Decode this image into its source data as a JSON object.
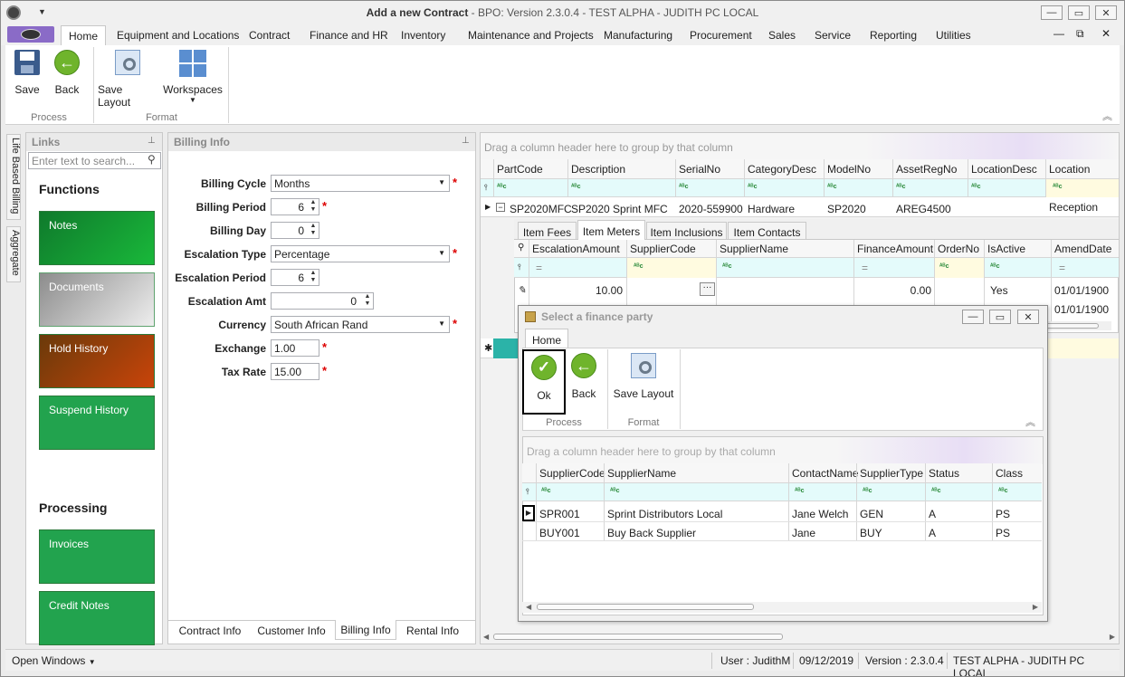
{
  "window": {
    "title_bold": "Add a new Contract",
    "title_rest": " - BPO: Version 2.3.0.4 - TEST ALPHA - JUDITH PC LOCAL"
  },
  "menu": [
    "Home",
    "Equipment and Locations",
    "Contract",
    "Finance and HR",
    "Inventory",
    "Maintenance and Projects",
    "Manufacturing",
    "Procurement",
    "Sales",
    "Service",
    "Reporting",
    "Utilities"
  ],
  "ribbon": {
    "save": "Save",
    "back": "Back",
    "save_layout": "Save Layout",
    "workspaces": "Workspaces",
    "group_process": "Process",
    "group_format": "Format"
  },
  "side_tabs": {
    "tab1": "Life Based Billing",
    "tab2": "Aggregate"
  },
  "links": {
    "title": "Links",
    "search_placeholder": "Enter text to search...",
    "functions_heading": "Functions",
    "functions": [
      "Notes",
      "Documents",
      "Hold History",
      "Suspend History"
    ],
    "processing_heading": "Processing",
    "processing": [
      "Invoices",
      "Credit Notes"
    ]
  },
  "billing": {
    "title": "Billing Info",
    "labels": [
      "Billing Cycle",
      "Billing Period",
      "Billing Day",
      "Escalation Type",
      "Escalation Period",
      "Escalation Amt",
      "Currency",
      "Exchange",
      "Tax Rate"
    ],
    "billing_cycle": "Months",
    "billing_period": "6",
    "billing_day": "0",
    "escalation_type": "Percentage",
    "escalation_period": "6",
    "escalation_amt": "0",
    "currency": "South African Rand",
    "exchange": "1.00",
    "tax_rate": "15.00",
    "tabs": [
      "Contract Info",
      "Customer Info",
      "Billing Info",
      "Rental Info"
    ]
  },
  "main_grid": {
    "group_hint": "Drag a column header here to group by that column",
    "columns": [
      "PartCode",
      "Description",
      "SerialNo",
      "CategoryDesc",
      "ModelNo",
      "AssetRegNo",
      "LocationDesc",
      "Location"
    ],
    "row": [
      "SP2020MFC",
      "SP2020 Sprint MFC",
      "2020-559900",
      "Hardware",
      "SP2020",
      "AREG4500",
      "",
      "Reception"
    ],
    "detail_tabs": [
      "Item Fees",
      "Item Meters",
      "Item Inclusions",
      "Item Contacts"
    ],
    "detail_columns": [
      "EscalationAmount",
      "SupplierCode",
      "SupplierName",
      "FinanceAmount",
      "OrderNo",
      "IsActive",
      "AmendDate"
    ],
    "detail_rows": [
      [
        "10.00",
        "",
        "",
        "0.00",
        "",
        "Yes",
        "01/01/1900"
      ],
      [
        "",
        "",
        "",
        "",
        "",
        "",
        "01/01/1900"
      ]
    ]
  },
  "dialog": {
    "title": "Select a finance party",
    "tab": "Home",
    "ok": "Ok",
    "back": "Back",
    "save_layout": "Save Layout",
    "group_process": "Process",
    "group_format": "Format",
    "group_hint": "Drag a column header here to group by that column",
    "columns": [
      "SupplierCode",
      "SupplierName",
      "ContactName",
      "SupplierType",
      "Status",
      "Class"
    ],
    "rows": [
      [
        "SPR001",
        "Sprint Distributors Local",
        "Jane Welch",
        "GEN",
        "A",
        "PS"
      ],
      [
        "BUY001",
        "Buy Back Supplier",
        "Jane",
        "BUY",
        "A",
        "PS"
      ]
    ]
  },
  "statusbar": {
    "open_windows": "Open Windows",
    "user": "User : JudithM",
    "date": "09/12/2019",
    "version": "Version : 2.3.0.4",
    "env": "TEST ALPHA - JUDITH PC LOCAL"
  },
  "colors": {
    "green_dark": "#1f9a48",
    "green_bright": "#22b34a",
    "grey_btn": "#b5b5b5",
    "hold_orange": "#c0440a",
    "filter_row": "#e4fbfb",
    "teal_cell": "#2bb3a8"
  },
  "icons": [
    "save-icon",
    "back-arrow-icon",
    "save-layout-icon",
    "workspaces-icon",
    "ok-check-icon",
    "pin-icon",
    "search-icon",
    "dropdown-arrow-icon",
    "close-icon"
  ]
}
